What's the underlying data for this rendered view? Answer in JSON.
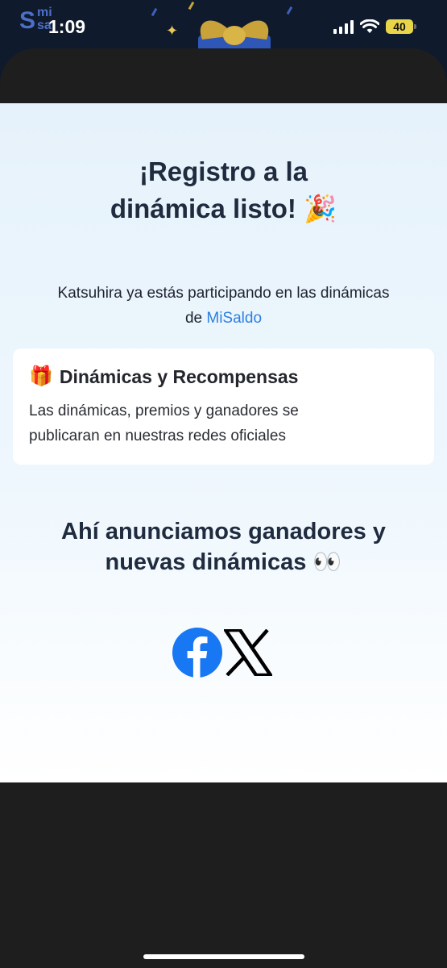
{
  "status_bar": {
    "time": "1:09",
    "battery": "40",
    "logo": {
      "s": "S",
      "mi": "mi",
      "sa": "sa"
    }
  },
  "page": {
    "title_line1": "¡Registro a la",
    "title_line2": "dinámica listo!",
    "title_emoji": "🎉",
    "subtitle_prefix": "Katsuhira ya estás participando en las dinámicas de",
    "brand": "MiSaldo",
    "card": {
      "emoji": "🎁",
      "title": "Dinámicas y Recompensas",
      "body": "Las dinámicas, premios y ganadores se publicaran en nuestras redes oficiales"
    },
    "announce_line1": "Ahí anunciamos ganadores y",
    "announce_line2": "nuevas dinámicas",
    "announce_emoji": "👀"
  },
  "colors": {
    "brand_link": "#2e7fe0",
    "facebook": "#1877f2",
    "battery": "#e9d54a"
  },
  "icons": {
    "facebook": "facebook-icon",
    "x": "x-icon"
  }
}
